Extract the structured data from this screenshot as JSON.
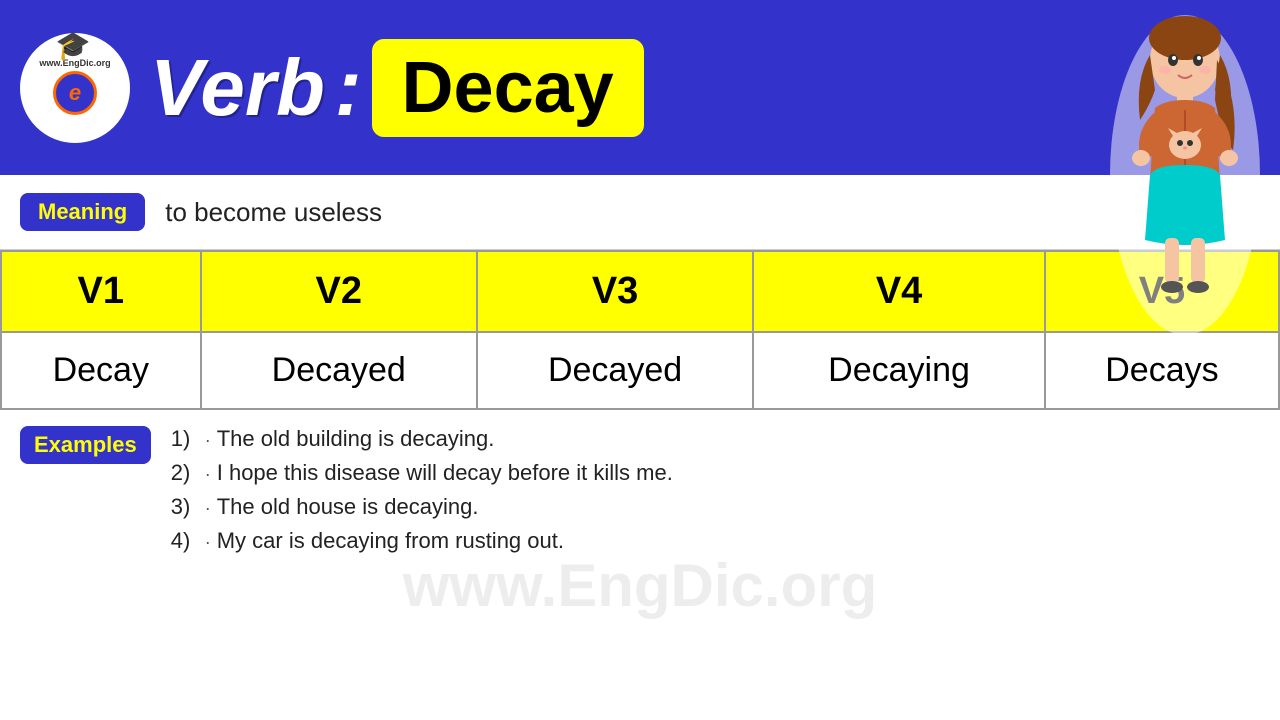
{
  "header": {
    "logo_url_text": "www.EngDic.org",
    "verb_label": "Verb",
    "colon": ":",
    "word": "Decay"
  },
  "meaning": {
    "badge": "Meaning",
    "text": "to become useless"
  },
  "table": {
    "headers": [
      "V1",
      "V2",
      "V3",
      "V4",
      "V5"
    ],
    "values": [
      "Decay",
      "Decayed",
      "Decayed",
      "Decaying",
      "Decays"
    ]
  },
  "examples": {
    "badge": "Examples",
    "list": [
      {
        "num": "1)",
        "text": "The old building is decaying."
      },
      {
        "num": "2)",
        "text": "I hope this disease will decay before it kills me."
      },
      {
        "num": "3)",
        "text": "The old house is decaying."
      },
      {
        "num": "4)",
        "text": "My car is decaying from rusting out."
      }
    ]
  },
  "watermark": "www.EngDic.org"
}
